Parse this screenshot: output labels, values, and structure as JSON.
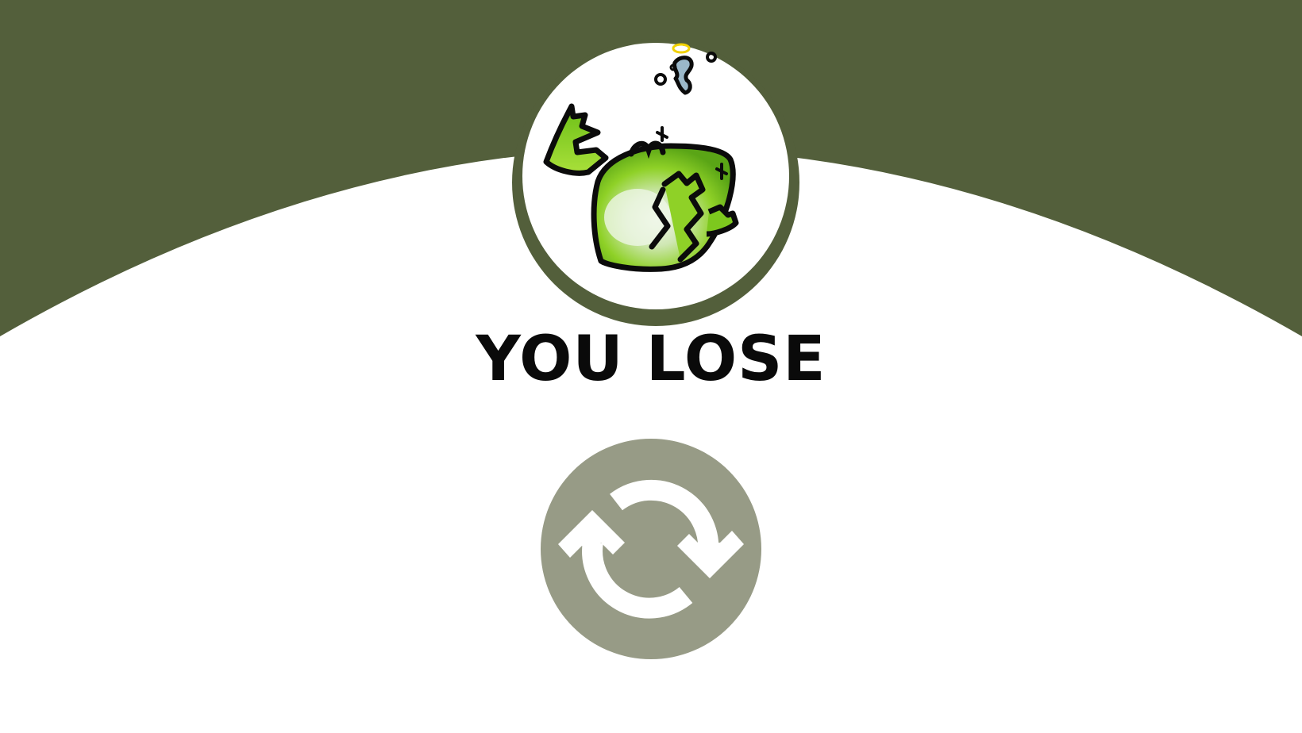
{
  "screen": {
    "title": "YOU LOSE",
    "state": "game-over"
  },
  "restart_button": {
    "icon": "restart-icon"
  },
  "character": {
    "icon": "defeated-frog-icon"
  },
  "colors": {
    "background_top": "#535f3b",
    "background_bottom": "#ffffff",
    "avatar_ring": "#535f3b",
    "button_fill": "#979b86",
    "title_text": "#0a0a0a",
    "frog_green": "#7dc81e"
  }
}
